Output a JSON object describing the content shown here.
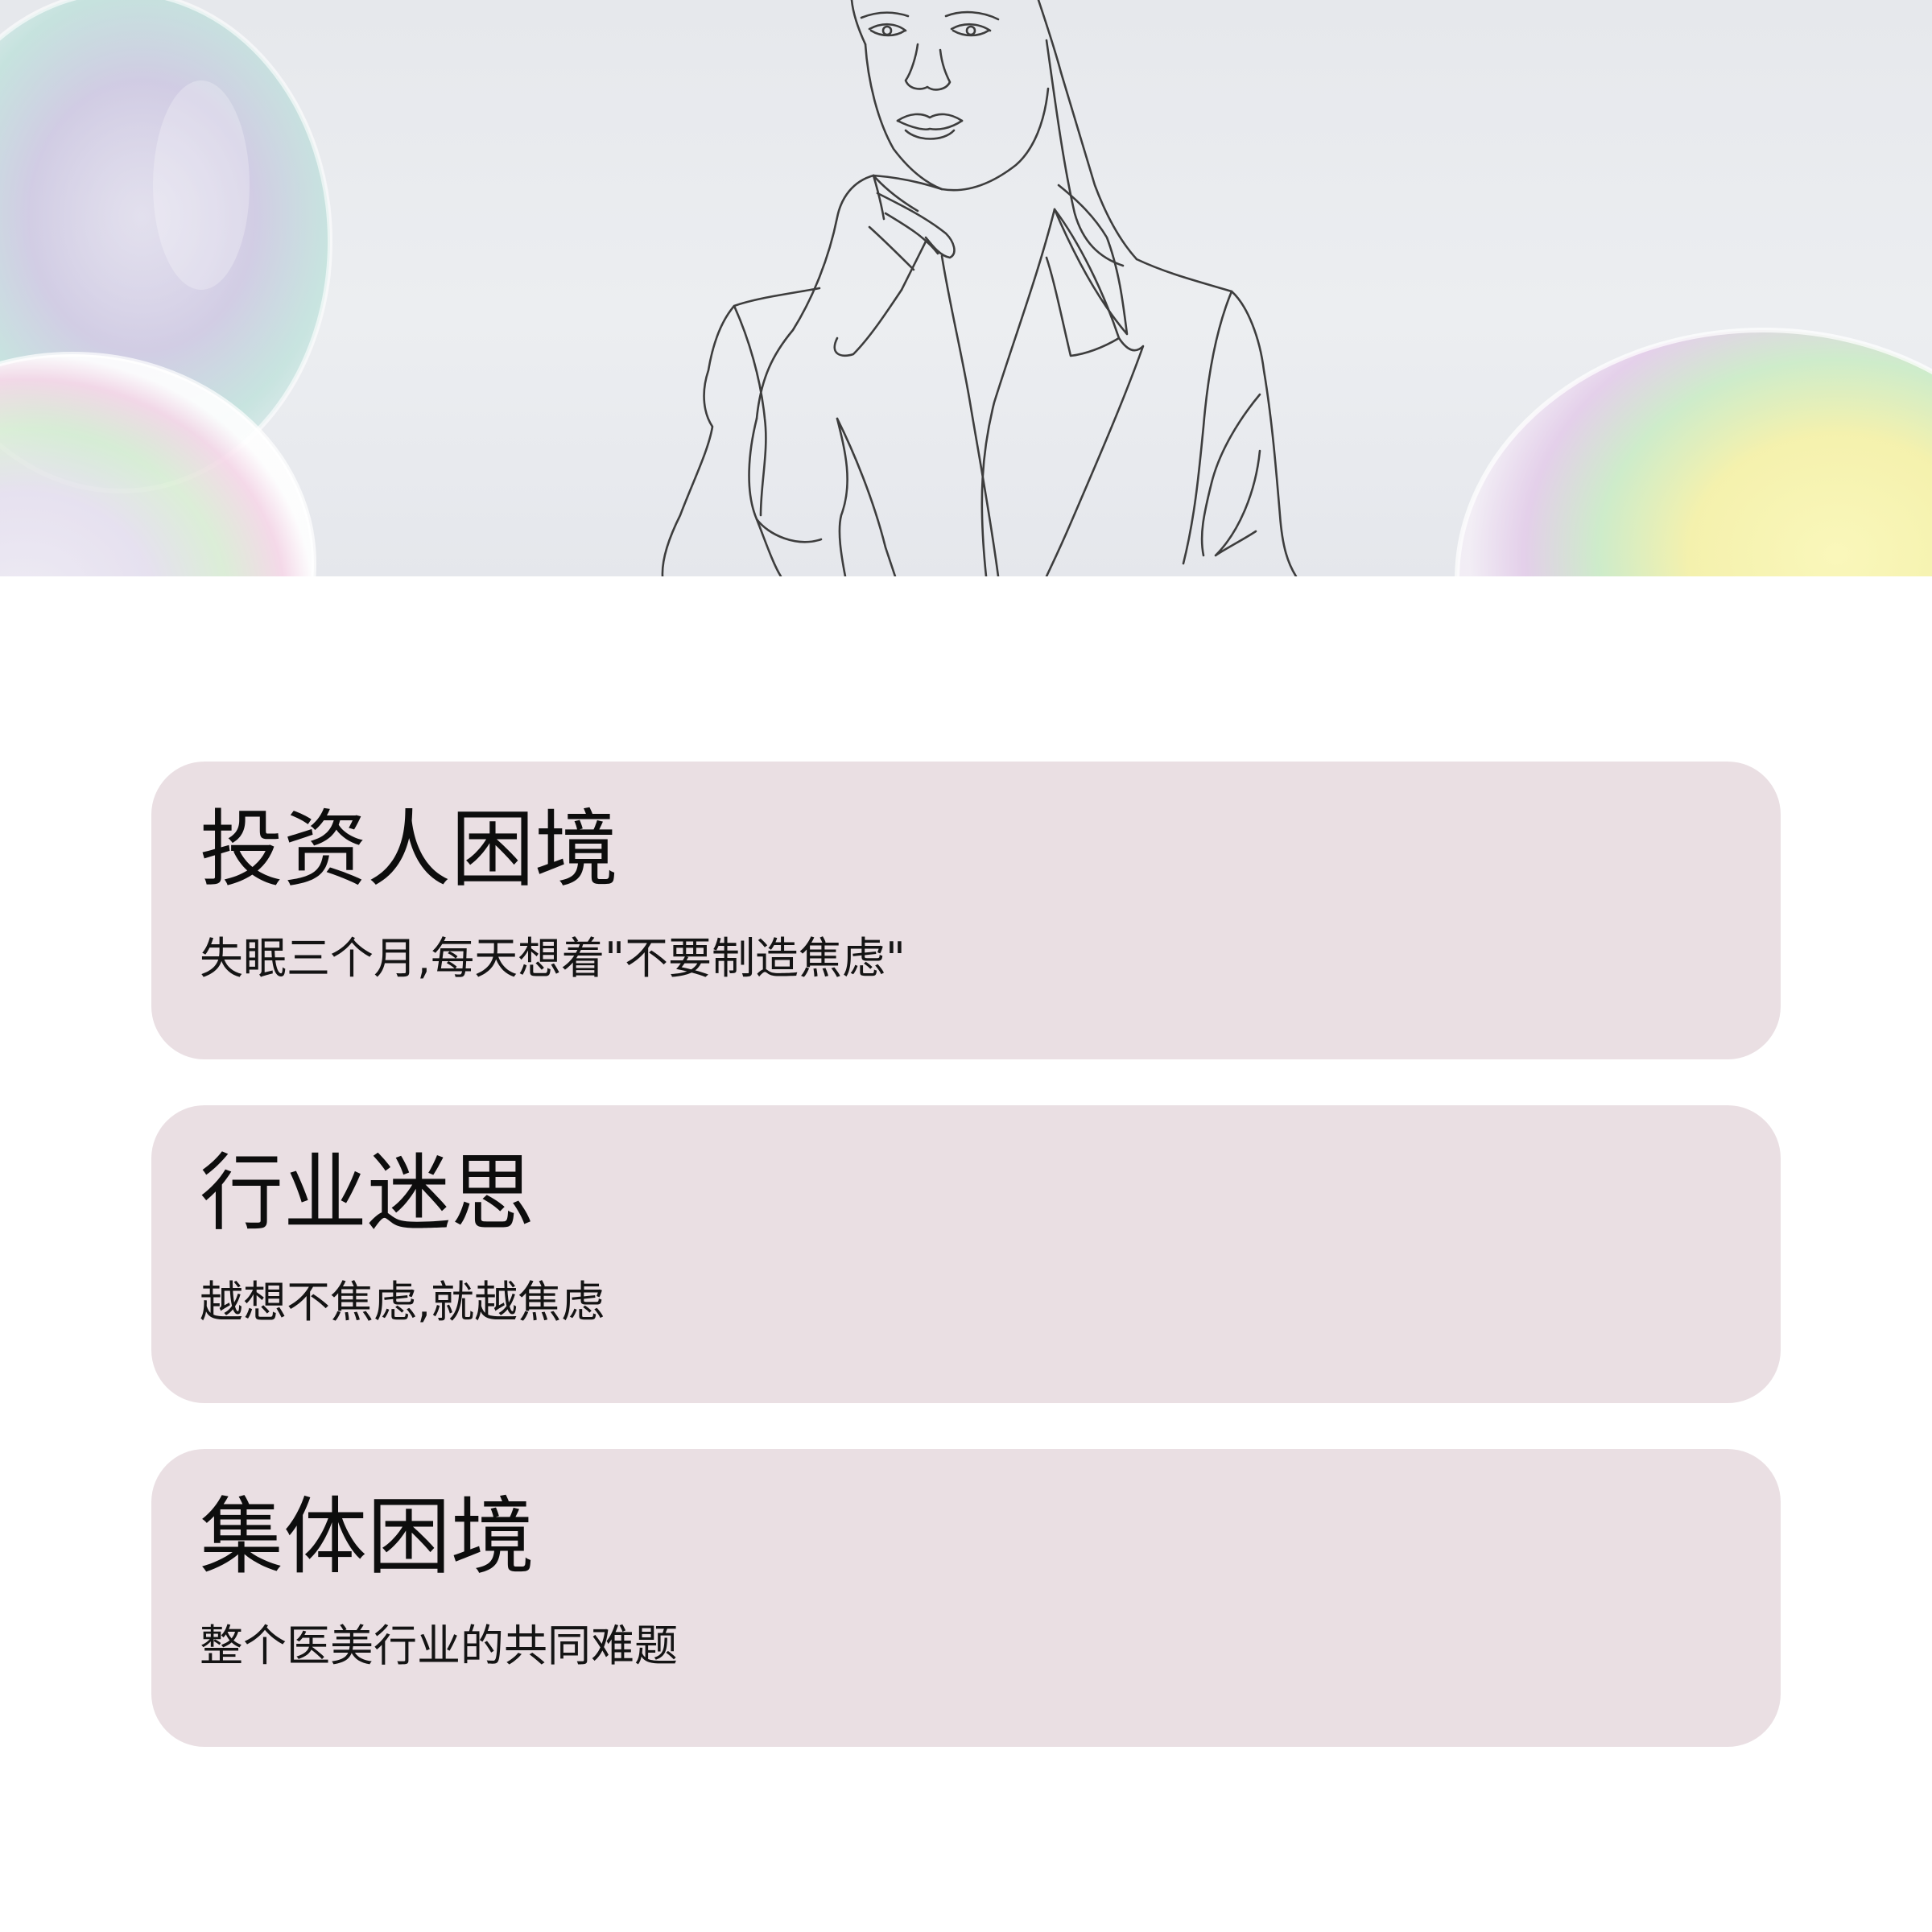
{
  "hero": {
    "image": "line-drawing-woman-thinking-with-iridescent-bubbles"
  },
  "cards": [
    {
      "title": "投资人困境",
      "description": "失眠三个月,每天想着\"不要制造焦虑\""
    },
    {
      "title": "行业迷思",
      "description": "越想不焦虑,就越焦虑"
    },
    {
      "title": "集体困境",
      "description": "整个医美行业的共同难题"
    }
  ],
  "colors": {
    "card_background": "#eadfe3",
    "hero_background": "#e8eaee",
    "text": "#0d0d0d"
  }
}
